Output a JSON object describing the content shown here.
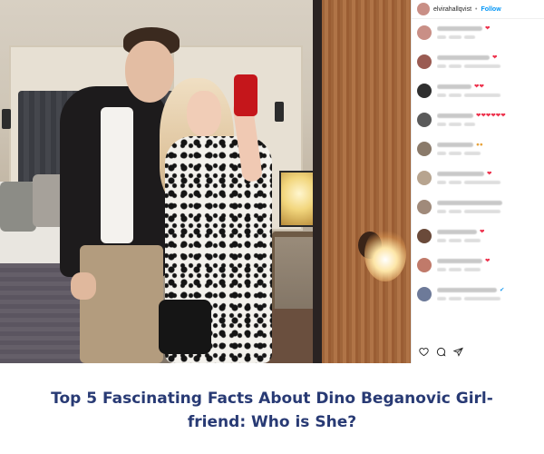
{
  "instagram": {
    "post_author": "elvirahallqvist",
    "separator": "•",
    "follow_label": "Follow",
    "comments": [
      {
        "emoji": "❤",
        "emoji_kind": "heart",
        "name_len": 50,
        "meta_len": 12
      },
      {
        "emoji": "❤",
        "emoji_kind": "heart",
        "name_len": 58,
        "meta_len": 40
      },
      {
        "emoji": "❤❤",
        "emoji_kind": "heart",
        "name_len": 38,
        "meta_len": 40
      },
      {
        "emoji": "❤❤❤❤❤❤",
        "emoji_kind": "heart",
        "name_len": 40,
        "meta_len": 12
      },
      {
        "emoji": "●●",
        "emoji_kind": "face",
        "name_len": 40,
        "meta_len": 18
      },
      {
        "emoji": "❤",
        "emoji_kind": "heart",
        "name_len": 52,
        "meta_len": 40
      },
      {
        "emoji": "",
        "emoji_kind": "none",
        "name_len": 72,
        "meta_len": 40
      },
      {
        "emoji": "❤",
        "emoji_kind": "heart",
        "name_len": 44,
        "meta_len": 18
      },
      {
        "emoji": "❤",
        "emoji_kind": "heart",
        "name_len": 50,
        "meta_len": 18
      },
      {
        "emoji": "✔",
        "emoji_kind": "check",
        "name_len": 66,
        "meta_len": 40
      }
    ]
  },
  "caption": {
    "title": "Top 5 Fascinating Facts About Dino Beganovic Girl-friend: Who is She?"
  },
  "colors": {
    "caption_text": "#283a74",
    "follow_link": "#0095f6",
    "heart": "#ed2f4a"
  }
}
